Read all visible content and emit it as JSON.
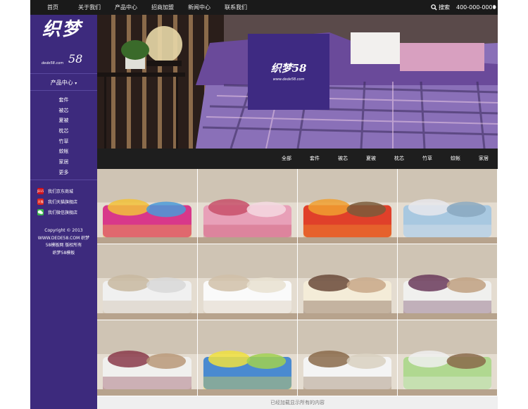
{
  "nav": {
    "items": [
      "首页",
      "关于我们",
      "产品中心",
      "招商加盟",
      "新闻中心",
      "联系我们"
    ],
    "search_label": "搜索",
    "phone": "400-000-0000"
  },
  "logo": {
    "title": "织梦",
    "number": "58",
    "domain": "dede58.com"
  },
  "sidebar": {
    "category_header": "产品中心",
    "categories": [
      "套件",
      "被芯",
      "夏被",
      "枕芯",
      "竹草",
      "蚊帐",
      "家居",
      "更多"
    ],
    "shops": [
      {
        "label": "我们京东商城",
        "icon": "jd-icon",
        "icon_text": "JD15",
        "color": "#d0121b"
      },
      {
        "label": "我们天猫旗舰店",
        "icon": "tmall-icon",
        "icon_text": "天猫",
        "color": "#e0251a"
      },
      {
        "label": "我们微信旗舰店",
        "icon": "wechat-icon",
        "icon_text": "",
        "color": "#3ab54a"
      }
    ],
    "copyright": [
      "Copyright © 2013",
      "WWW.DEDE58.COM 织梦",
      "58模板网 版权所有",
      "织梦58模板"
    ]
  },
  "hero": {
    "title": "织梦58",
    "subtitle": "www.dede58.com"
  },
  "filters": [
    "全部",
    "套件",
    "被芯",
    "夏被",
    "枕芯",
    "竹草",
    "蚊帐",
    "家居"
  ],
  "products": [
    {
      "name": "product-bedding-floral",
      "palette": [
        "#d8388a",
        "#f2c23a",
        "#4a9ad8"
      ]
    },
    {
      "name": "product-bedding-pink",
      "palette": [
        "#e8a0b8",
        "#c8506a",
        "#f4d8e0"
      ]
    },
    {
      "name": "product-bedding-red-stripes",
      "palette": [
        "#e0402a",
        "#f0a030",
        "#7a5a3a"
      ]
    },
    {
      "name": "product-pillow-blue-stripe",
      "palette": [
        "#a8c8e0",
        "#e8e8ec",
        "#8aa8c0"
      ]
    },
    {
      "name": "product-pillow-white",
      "palette": [
        "#f0f0f0",
        "#c8b8a0",
        "#d8d8d8"
      ]
    },
    {
      "name": "product-pillow-white-bench",
      "palette": [
        "#fafafa",
        "#d0c0a8",
        "#e8e0d0"
      ]
    },
    {
      "name": "product-pillow-cream",
      "palette": [
        "#f4ecd8",
        "#6a4a3a",
        "#c8a888"
      ]
    },
    {
      "name": "product-pillow-flowers",
      "palette": [
        "#f0f0ee",
        "#6a3a5a",
        "#c0a080"
      ]
    },
    {
      "name": "product-pillow-tulips",
      "palette": [
        "#f0f0ee",
        "#8a3a4a",
        "#b89878"
      ]
    },
    {
      "name": "product-pillow-blue-print",
      "palette": [
        "#4a8ad0",
        "#f0e040",
        "#a0d050"
      ]
    },
    {
      "name": "product-pillow-white-fiber",
      "palette": [
        "#f4f4f4",
        "#8a6a4a",
        "#d8d0c0"
      ]
    },
    {
      "name": "product-pillow-green",
      "palette": [
        "#b0d890",
        "#f0f0f0",
        "#8a6a4a"
      ]
    }
  ],
  "footer": {
    "text": "已经加载显示所有的内容"
  },
  "colors": {
    "sidebar": "#3d2a7d",
    "topbar": "#1a1a1a",
    "filterbar": "#1e1e1e"
  }
}
